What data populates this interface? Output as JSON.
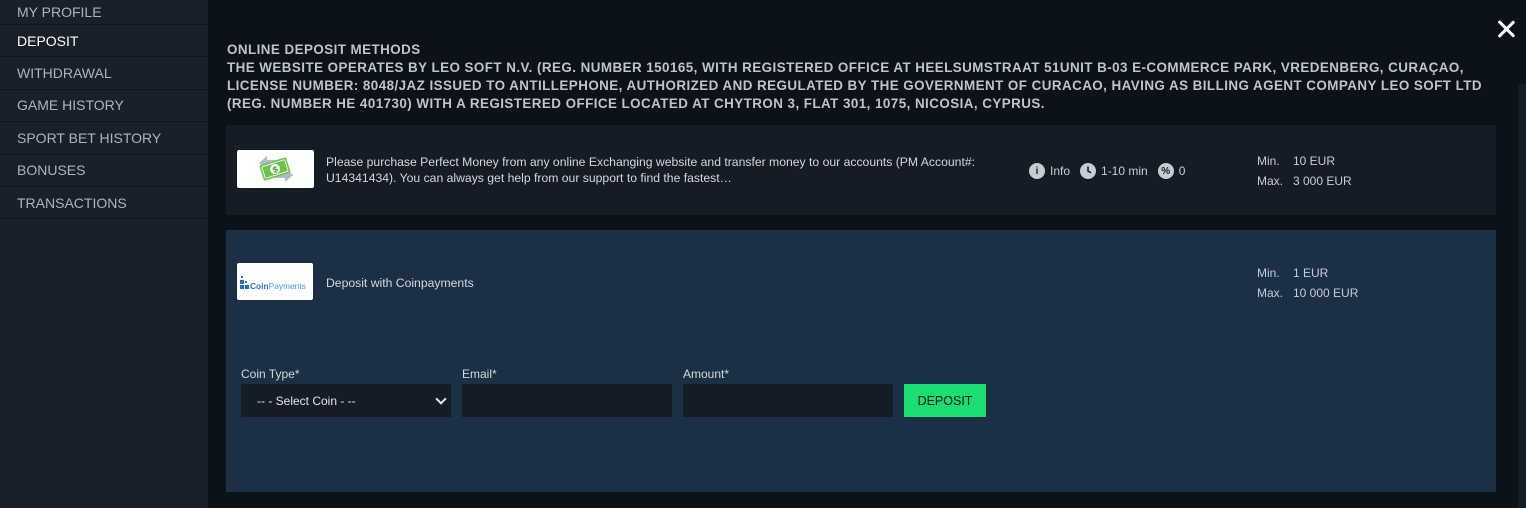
{
  "sidebar": {
    "items": [
      {
        "label": "MY PROFILE"
      },
      {
        "label": "DEPOSIT"
      },
      {
        "label": "WITHDRAWAL"
      },
      {
        "label": "GAME HISTORY"
      },
      {
        "label": "SPORT BET HISTORY"
      },
      {
        "label": "BONUSES"
      },
      {
        "label": "TRANSACTIONS"
      }
    ],
    "active": "DEPOSIT"
  },
  "main": {
    "title": "ONLINE DEPOSIT METHODS",
    "legal": "THE WEBSITE OPERATES BY LEO SOFT N.V. (REG. NUMBER 150165, WITH REGISTERED OFFICE AT HEELSUMSTRAAT 51UNIT B-03 E-COMMERCE PARK, VREDENBERG, CURAÇAO, LICENSE NUMBER: 8048/JAZ ISSUED TO ANTILLEPHONE, AUTHORIZED AND REGULATED BY THE GOVERNMENT OF CURACAO, HAVING AS BILLING AGENT COMPANY LEO SOFT LTD (REG. NUMBER HE 401730) WITH A REGISTERED OFFICE LOCATED AT CHYTRON 3, FLAT 301, 1075, NICOSIA, CYPRUS."
  },
  "methods": [
    {
      "description": "Please purchase Perfect Money from any online Exchanging website and transfer money to our accounts (PM Account#: U14341434). You can always get help from our support to find the fastest…",
      "info_label": "Info",
      "time_label": "1-10 min",
      "fee_label": "0",
      "min_label": "Min.",
      "min_value": "10 EUR",
      "max_label": "Max.",
      "max_value": "3 000 EUR",
      "logo_icon": "money-transfer-icon"
    },
    {
      "description": "Deposit with Coinpayments",
      "logo_text": "CoinPayments",
      "min_label": "Min.",
      "min_value": "1 EUR",
      "max_label": "Max.",
      "max_value": "10 000 EUR",
      "form": {
        "coin_label": "Coin Type*",
        "coin_selected": "-- - Select Coin - --",
        "email_label": "Email*",
        "email_value": "",
        "amount_label": "Amount*",
        "amount_value": "",
        "deposit_label": "DEPOSIT"
      }
    }
  ],
  "colors": {
    "accent_green": "#1bde70",
    "sidebar_bg": "#18202a",
    "main_bg": "#0c1219",
    "card_bg": "#141c25",
    "card_expanded_bg": "#1b2f45"
  }
}
